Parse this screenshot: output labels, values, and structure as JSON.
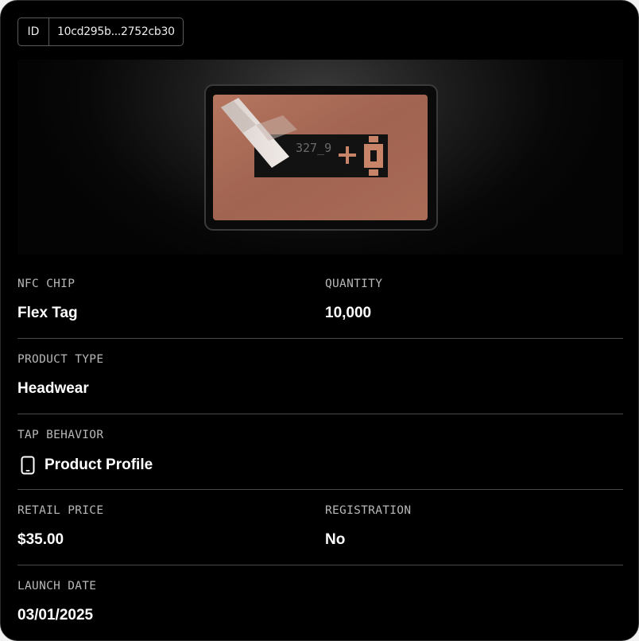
{
  "id_badge": {
    "label": "ID",
    "value": "10cd295b...2752cb30"
  },
  "hero": {
    "chip_text": "327_9",
    "colors": {
      "copper": "#b0705a",
      "frame": "#0c0c0c"
    }
  },
  "fields": {
    "nfc_chip": {
      "label": "NFC CHIP",
      "value": "Flex Tag"
    },
    "quantity": {
      "label": "QUANTITY",
      "value": "10,000"
    },
    "product_type": {
      "label": "PRODUCT TYPE",
      "value": "Headwear"
    },
    "tap_behavior": {
      "label": "TAP BEHAVIOR",
      "value": "Product Profile",
      "icon": "phone-icon"
    },
    "retail_price": {
      "label": "RETAIL PRICE",
      "value": "$35.00"
    },
    "registration": {
      "label": "REGISTRATION",
      "value": "No"
    },
    "launch_date": {
      "label": "LAUNCH DATE",
      "value": "03/01/2025"
    }
  }
}
